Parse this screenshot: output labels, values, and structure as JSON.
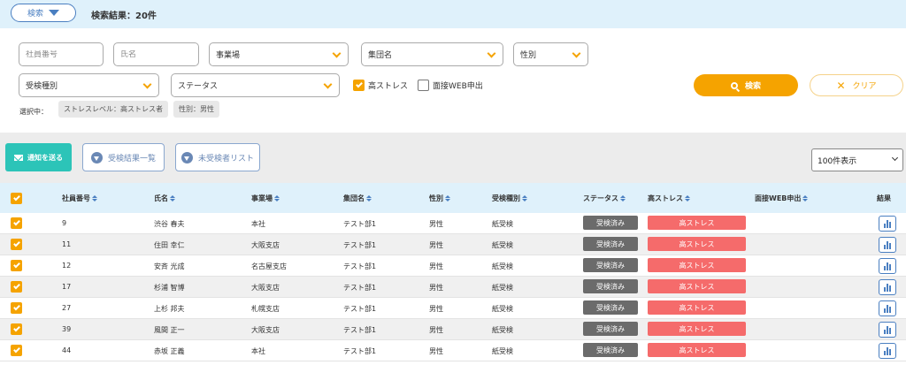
{
  "topbar": {
    "search_toggle_label": "検索",
    "result_count": "検索結果：20件"
  },
  "filters": {
    "employee_no_placeholder": "社員番号",
    "name_placeholder": "氏名",
    "office_label": "事業場",
    "group_label": "集団名",
    "gender_label": "性別",
    "exam_type_label": "受検種別",
    "status_label": "ステータス",
    "high_stress_label": "高ストレス",
    "high_stress_checked": true,
    "web_interview_label": "面接WEB申出",
    "web_interview_checked": false,
    "search_button": "検索",
    "clear_button": "クリア",
    "selected_label": "選択中：",
    "chips": [
      "ストレスレベル：高ストレス者",
      "性別：男性"
    ]
  },
  "actions": {
    "notify_button": "通知を送る",
    "results_list_button": "受検結果一覧",
    "unexamined_list_button": "未受検者リスト",
    "page_size": "100件表示"
  },
  "table": {
    "headers": {
      "employee_no": "社員番号",
      "name": "氏名",
      "office": "事業場",
      "group": "集団名",
      "gender": "性別",
      "exam_type": "受検種別",
      "status": "ステータス",
      "high_stress": "高ストレス",
      "web_interview": "面接WEB申出",
      "result": "結果"
    },
    "rows": [
      {
        "no": "9",
        "name": "渋谷 春夫",
        "office": "本社",
        "group": "テスト部1",
        "gender": "男性",
        "type": "紙受検",
        "status": "受検済み",
        "stress": "高ストレス"
      },
      {
        "no": "11",
        "name": "住田 幸仁",
        "office": "大阪支店",
        "group": "テスト部1",
        "gender": "男性",
        "type": "紙受検",
        "status": "受検済み",
        "stress": "高ストレス"
      },
      {
        "no": "12",
        "name": "安斉 光成",
        "office": "名古屋支店",
        "group": "テスト部1",
        "gender": "男性",
        "type": "紙受検",
        "status": "受検済み",
        "stress": "高ストレス"
      },
      {
        "no": "17",
        "name": "杉浦 智博",
        "office": "大阪支店",
        "group": "テスト部1",
        "gender": "男性",
        "type": "紙受検",
        "status": "受検済み",
        "stress": "高ストレス"
      },
      {
        "no": "27",
        "name": "上杉 邦夫",
        "office": "札幌支店",
        "group": "テスト部1",
        "gender": "男性",
        "type": "紙受検",
        "status": "受検済み",
        "stress": "高ストレス"
      },
      {
        "no": "39",
        "name": "風間 正一",
        "office": "大阪支店",
        "group": "テスト部1",
        "gender": "男性",
        "type": "紙受検",
        "status": "受検済み",
        "stress": "高ストレス"
      },
      {
        "no": "44",
        "name": "赤坂 正義",
        "office": "本社",
        "group": "テスト部1",
        "gender": "男性",
        "type": "紙受検",
        "status": "受検済み",
        "stress": "高ストレス"
      }
    ]
  },
  "colors": {
    "accent": "#f5a300",
    "teal": "#2cc4b8",
    "stress": "#f56b6b",
    "status": "#6b6b6b",
    "header_bg": "#dff1fb"
  }
}
